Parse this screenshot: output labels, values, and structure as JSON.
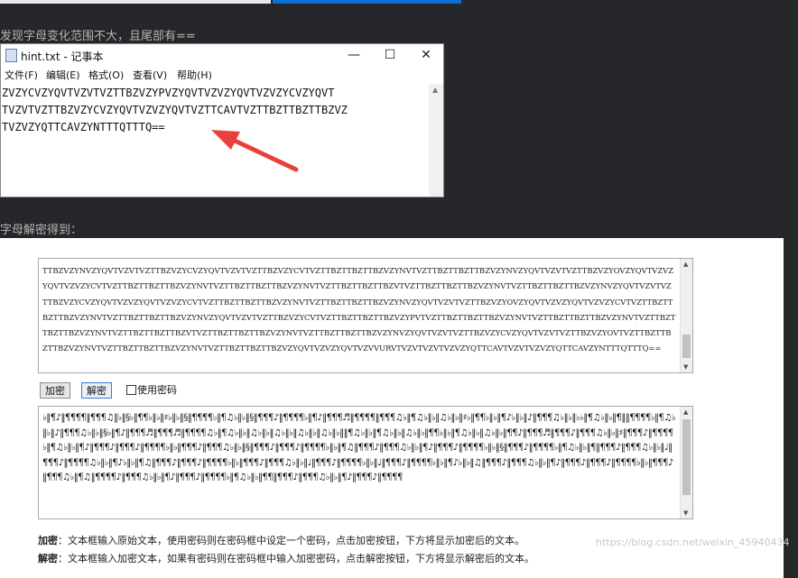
{
  "caption1": "发现字母变化范围不大，且尾部有==",
  "caption2": "字母解密得到：",
  "notepad": {
    "title": "hint.txt - 记事本",
    "menu": [
      "文件(F)",
      "编辑(E)",
      "格式(O)",
      "查看(V)",
      "帮助(H)"
    ],
    "lines": [
      "ZVZYCVZYQVTVZVTVZTTBZVZYPVZYQVTVZVZYQVTVZVZYCVZYQVT",
      "TVZVTVZTTBZVZYCVZYQVTVZVZYQVTVZTTCAVTVZTTBZTTBZTTBZVZ",
      "TVZVZYQTTCAVZYNTTTQTTTQ=="
    ]
  },
  "tool": {
    "input_text": "TTBZVZYNVZYQVTVZVTVZTTBZVZYCVZYQVTVZVTVZTTBZVZYCVTVZTTBZTTBZTTBZVZYNVTVZTTBZTTBZTTBZVZYNVZYQVTVZVTVZTTBZVZYOVZYQVTVZVZYQVTVZVZYCVTVZTTBZTTBZTTBZVZYNVTVZTTBZTTBZTTBZVZYNVTVZTTBZTTBZTTBZVTVZTTBZTTBZTTBZVZYNVTVZTTBZTTBZTTBZVZYNVZYQVTVZVTVZTTBZVZYCVZYQVTVZVZYQVTVZVZYCVTVZTTBZTTBZTTBZVZYNVTVZTTBZTTBZTTBZVZYNVZYQVTVZVTVZTTBZVZYOVZYQVTVZVZYQVTVZVZYCVTVZTTBZTTBZTTBZVZYNVTVZTTBZTTBZTTBZVZYNVZYQVTVZVTVZTTBZVZYCVTVZTTBZTTBZTTBZVZYPVTVZTTBZTTBZTTBZVZYNVTVZTTBZTTBZTTBZVZYNVTVZTTBZTTBZTTBZVZYNVTVZTTBZTTBZTTBZVTVZTTBZTTBZTTBZVZYNVTVZTTBZTTBZTTBZVZYNVZYQVTVZVTVZTTBZVZYCVZYQVTVZVTVZTTBZVZYOVTVZTTBZTTBZTTBZVZYNVTVZTTBZTTBZTTBZVZYNVTVZTTBZTTBZTTBZVZYQVTVZVZYQVTVZVVURVTVZVTVZVTVZVZYQTTCAVTVZVTVZVZYQTTCAVZYNTTTQTTTQ==",
    "encrypt_label": "加密",
    "decrypt_label": "解密",
    "password_label": "使用密码",
    "output_text": "♭‖¶♪‖¶¶¶¶‖¶¶¶♫‖♭‖§♭‖¶¶♭‖♭‖♯♭‖♭‖§‖¶¶¶¶♭‖¶♫♭‖♭‖§‖¶¶¶♪‖¶¶¶¶♭‖¶♪‖¶¶¶♬‖¶¶¶¶‖¶¶¶♫♭‖¶♫♭‖♭‖♫♭‖♭‖♯♭‖¶¶♭‖♭‖¶♪♭‖♭‖♪‖¶¶¶♫♭‖♭‖♭♭‖¶♫♭‖♭‖¶‖‖¶¶¶¶♭‖¶♫♭‖♭‖♪‖¶¶¶♫♭‖♭‖§♭‖¶♪‖¶¶¶♬‖¶¶¶♬‖¶¶¶¶♫♭‖¶♫♭‖♭‖♫♭‖♭‖♫♭‖♭‖♫♭‖♭‖♫♭‖♭‖‖¶♫♭‖♭‖¶♫♭‖♭‖♫♭‖♭‖¶¶♭‖♭‖¶♫♭‖♭‖♫♭‖♭‖¶¶♪‖¶¶¶♬‖¶¶¶♪‖¶¶¶♫♭‖♭‖♯‖¶¶¶♪‖¶¶¶¶♭‖¶♫♭‖♭‖¶♪‖¶¶¶♪‖¶¶¶♪‖¶¶¶¶♭‖♭‖¶¶¶♪‖¶¶¶♫♭‖♭‖§‖¶¶¶♪‖¶¶¶♪‖¶¶¶¶♭‖♭‖¶♫‖¶¶¶♪‖¶¶¶♫♭‖♭‖¶♪‖¶¶¶♪‖¶¶¶¶♭‖♭‖§‖¶¶¶♪‖¶¶¶¶♭‖¶♫♭‖♭‖¶‖¶¶¶♪‖¶¶¶♫♭‖♭‖♩‖¶¶¶♪‖¶¶¶¶♫♭‖♭‖¶♪♭‖♭‖¶♫‖¶¶¶♪‖¶¶¶♪‖¶¶¶¶♭‖♭‖¶¶¶♪‖¶¶¶♫♭‖♭‖♩‖¶¶¶♪‖¶¶¶¶♭‖♭‖♩‖¶¶¶♪‖¶¶¶¶♭‖♭‖¶♪♭‖♭‖♫‖¶¶¶♪‖¶¶¶♫♭‖♭‖¶♪‖¶¶¶♪‖¶¶¶♪‖¶¶¶¶♭‖♭‖¶¶¶♪‖¶¶¶♫♭‖¶♫‖¶¶¶¶♪‖¶¶¶♫♭‖♭‖¶♪‖¶¶¶♪‖¶¶¶¶♭‖¶♫♭‖♭‖¶¶‖¶¶¶♪‖¶¶¶♫♭‖♭‖¶♪‖¶¶¶♪‖¶¶¶¶",
    "desc_bold": "加密",
    "desc_text": "：文本框输入原始文本，使用密码则在密码框中设定一个密码，点击加密按钮，下方将显示加密后的文本。",
    "desc2_bold": "解密",
    "desc2_text": "：文本框输入加密文本，如果有密码则在密码框中输入加密密码，点击解密按钮，下方将显示解密后的文本。"
  },
  "watermark": "https://blog.csdn.net/weixin_45940434",
  "colors": {
    "background": "#26272a",
    "arrow": "#e8413c",
    "accent": "#0b6fd6"
  }
}
